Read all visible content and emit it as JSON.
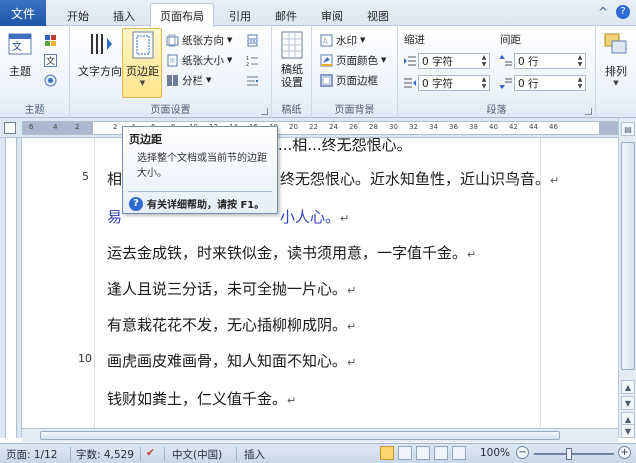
{
  "tabs": {
    "file": "文件",
    "items": [
      "开始",
      "插入",
      "页面布局",
      "引用",
      "邮件",
      "审阅",
      "视图"
    ],
    "active": "页面布局",
    "help_glyph": "?",
    "expand_glyph": "^"
  },
  "ribbon": {
    "theme_group": {
      "label": "主题",
      "themes_button": "主题",
      "colors_icon": "theme-colors-icon",
      "fonts_icon": "theme-fonts-icon",
      "effects_icon": "theme-effects-icon"
    },
    "page_setup": {
      "label": "页面设置",
      "text_direction": "文字方向",
      "margins": "页边距",
      "orientation": "纸张方向",
      "size": "纸张大小",
      "columns": "分栏",
      "breaks_icon": "breaks-icon",
      "line_numbers_icon": "line-numbers-icon",
      "hyphenation_icon": "hyphenation-icon"
    },
    "draft_group": {
      "label": "稿纸",
      "draft_button": "稿纸\n设置"
    },
    "page_background": {
      "label": "页面背景",
      "watermark": "水印",
      "page_color": "页面颜色",
      "page_borders": "页面边框"
    },
    "paragraph": {
      "label": "段落",
      "indent_label": "缩进",
      "spacing_label": "间距",
      "indent_left": "0 字符",
      "indent_right": "0 字符",
      "space_before": "0 行",
      "space_after": "0 行"
    },
    "arrange": {
      "label": "排列"
    }
  },
  "ruler": {
    "ticks": [
      "6",
      "4",
      "2",
      "2",
      "4",
      "6",
      "8",
      "10",
      "12",
      "14",
      "16",
      "18",
      "20",
      "22",
      "24",
      "26",
      "28",
      "30",
      "32",
      "34",
      "36",
      "38",
      "40",
      "42",
      "44",
      "46"
    ]
  },
  "tooltip": {
    "title": "页边距",
    "body": "选择整个文档或当前节的边距大小。",
    "help": "有关详细帮助，请按 F1。"
  },
  "document": {
    "lines": [
      {
        "number": "",
        "text": "相...终无怨恨心。近水知鱼性，近山识鸟音。",
        "full": "终无怨恨心。近水知鱼性，近山识鸟音。"
      },
      {
        "number": "5",
        "text": "相"
      },
      {
        "number": "",
        "text": "易...小人心。",
        "blue": true
      },
      {
        "number": "",
        "text": "运去金成铁，时来铁似金，读书须用意，一字值千金。"
      },
      {
        "number": "",
        "text": "逢人且说三分话，未可全抛一片心。"
      },
      {
        "number": "",
        "text": "有意栽花花不发，无心插柳柳成阴。"
      },
      {
        "number": "10",
        "text": "画虎画皮难画骨，知人知面不知心。"
      },
      {
        "number": "",
        "text": "钱财如粪土，仁义值千金。"
      }
    ],
    "top_partial": "...相...终无怨恨心。",
    "line1_tail": "终无怨恨心。近水知鱼性，近山识鸟音。",
    "line2_left": "易",
    "line2_tail": "小人心。",
    "line3": "运去金成铁，时来铁似金，读书须用意，一字值千金。",
    "line4": "逢人且说三分话，未可全抛一片心。",
    "line5": "有意栽花花不发，无心插柳柳成阴。",
    "line6": "画虎画皮难画骨，知人知面不知心。",
    "line7": "钱财如粪土，仁义值千金。",
    "no5": "5",
    "no10": "10",
    "first_char": "相",
    "para_mark": "↵"
  },
  "statusbar": {
    "page": "页面: 1/12",
    "words": "字数: 4,529",
    "language": "中文(中国)",
    "mode": "插入",
    "zoom": "100%",
    "zoom_minus": "−",
    "zoom_plus": "+"
  }
}
